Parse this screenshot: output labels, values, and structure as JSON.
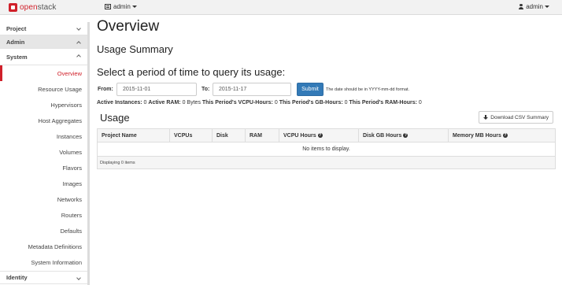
{
  "navbar": {
    "brand_prefix": "open",
    "brand_suffix": "stack",
    "project_menu": "admin",
    "user_menu": "admin"
  },
  "sidebar": {
    "project": "Project",
    "admin": "Admin",
    "system": "System",
    "items": [
      {
        "label": "Overview",
        "active": true
      },
      {
        "label": "Resource Usage"
      },
      {
        "label": "Hypervisors"
      },
      {
        "label": "Host Aggregates"
      },
      {
        "label": "Instances"
      },
      {
        "label": "Volumes"
      },
      {
        "label": "Flavors"
      },
      {
        "label": "Images"
      },
      {
        "label": "Networks"
      },
      {
        "label": "Routers"
      },
      {
        "label": "Defaults"
      },
      {
        "label": "Metadata Definitions"
      },
      {
        "label": "System Information"
      }
    ],
    "identity": "Identity"
  },
  "main": {
    "title": "Overview",
    "summary_heading": "Usage Summary",
    "period_heading": "Select a period of time to query its usage:",
    "from_label": "From:",
    "from_value": "2015-11-01",
    "to_label": "To:",
    "to_value": "2015-11-17",
    "submit_label": "Submit",
    "date_hint": "The date should be in YYYY-mm-dd format.",
    "stats": {
      "active_instances_label": "Active Instances:",
      "active_instances": "0",
      "active_ram_label": "Active RAM:",
      "active_ram": "0 Bytes",
      "vcpu_hours_label": "This Period's VCPU-Hours:",
      "vcpu_hours": "0",
      "gb_hours_label": "This Period's GB-Hours:",
      "gb_hours": "0",
      "ram_hours_label": "This Period's RAM-Hours:",
      "ram_hours": "0"
    },
    "usage_title": "Usage",
    "csv_button": "Download CSV Summary",
    "table": {
      "columns": [
        "Project Name",
        "VCPUs",
        "Disk",
        "RAM",
        "VCPU Hours",
        "Disk GB Hours",
        "Memory MB Hours"
      ],
      "empty_message": "No items to display.",
      "footer": "Displaying 0 items"
    }
  }
}
